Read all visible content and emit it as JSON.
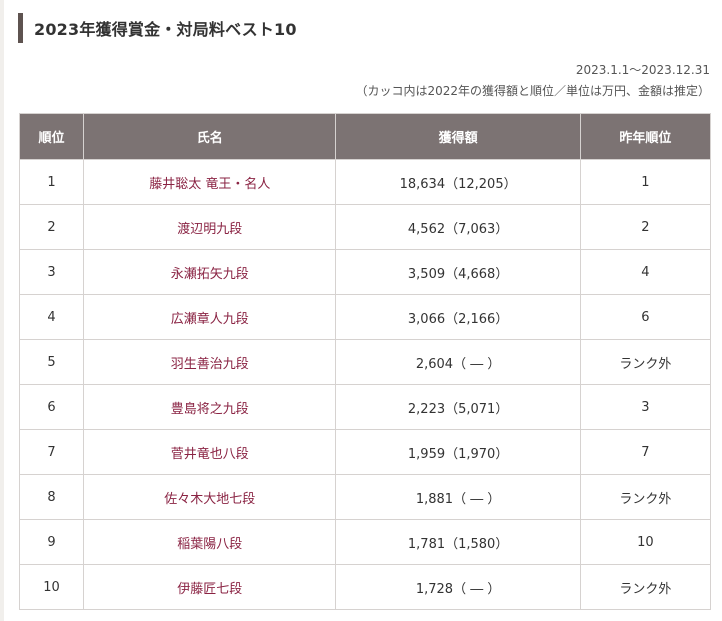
{
  "heading": {
    "title": "2023年獲得賞金・対局料ベスト10"
  },
  "meta": {
    "period": "2023.1.1～2023.12.31",
    "note": "（カッコ内は2022年の獲得額と順位／単位は万円、金額は推定）"
  },
  "table": {
    "headers": [
      "順位",
      "氏名",
      "獲得額",
      "昨年順位"
    ],
    "rows": [
      {
        "rank": "1",
        "name": "藤井聡太 竜王・名人",
        "amount": "18,634（12,205）",
        "prev": "1"
      },
      {
        "rank": "2",
        "name": "渡辺明九段",
        "amount": "4,562（7,063）",
        "prev": "2"
      },
      {
        "rank": "3",
        "name": "永瀬拓矢九段",
        "amount": "3,509（4,668）",
        "prev": "4"
      },
      {
        "rank": "4",
        "name": "広瀬章人九段",
        "amount": "3,066（2,166）",
        "prev": "6"
      },
      {
        "rank": "5",
        "name": "羽生善治九段",
        "amount": "2,604（ ― ）",
        "prev": "ランク外"
      },
      {
        "rank": "6",
        "name": "豊島将之九段",
        "amount": "2,223（5,071）",
        "prev": "3"
      },
      {
        "rank": "7",
        "name": "菅井竜也八段",
        "amount": "1,959（1,970）",
        "prev": "7"
      },
      {
        "rank": "8",
        "name": "佐々木大地七段",
        "amount": "1,881（ ― ）",
        "prev": "ランク外"
      },
      {
        "rank": "9",
        "name": "稲葉陽八段",
        "amount": "1,781（1,580）",
        "prev": "10"
      },
      {
        "rank": "10",
        "name": "伊藤匠七段",
        "amount": "1,728（ ― ）",
        "prev": "ランク外"
      }
    ]
  },
  "colors": {
    "header_bg": "#7c7373",
    "heading_bar": "#5e5350",
    "name_link": "#8a2343",
    "border": "#d6d2d0"
  }
}
